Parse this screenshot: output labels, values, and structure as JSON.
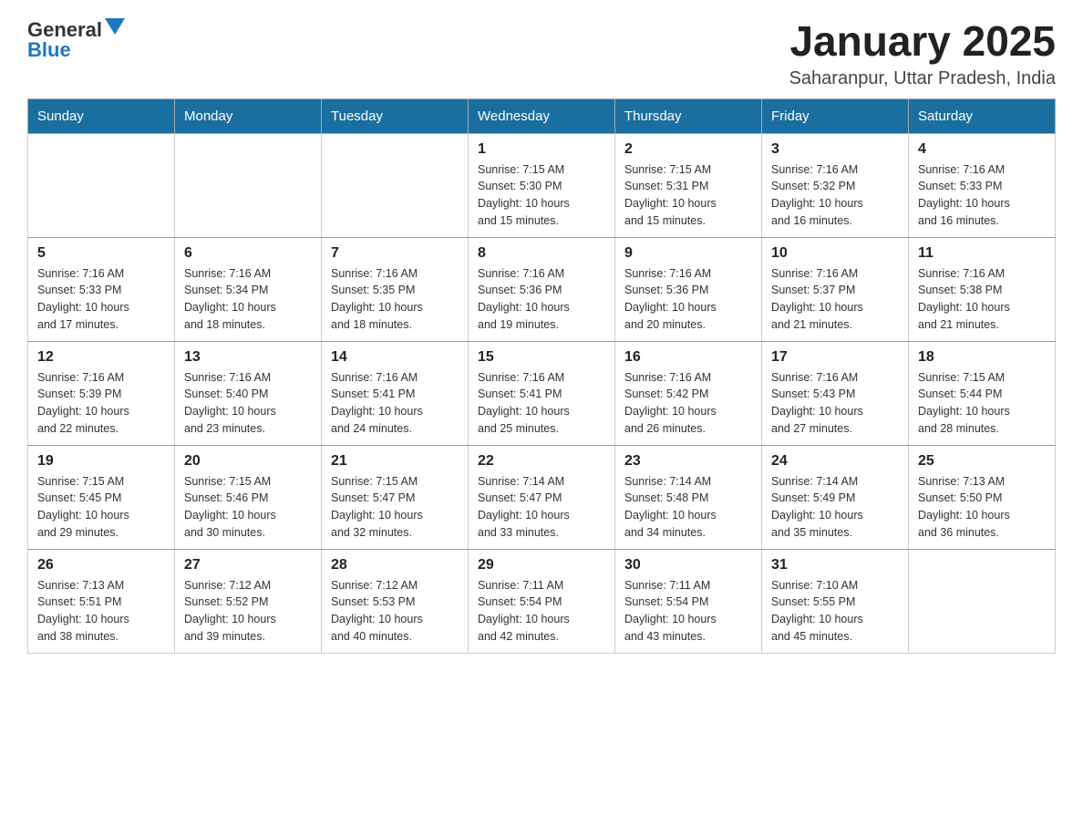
{
  "header": {
    "logo_general": "General",
    "logo_blue": "Blue",
    "month_title": "January 2025",
    "location": "Saharanpur, Uttar Pradesh, India"
  },
  "days_of_week": [
    "Sunday",
    "Monday",
    "Tuesday",
    "Wednesday",
    "Thursday",
    "Friday",
    "Saturday"
  ],
  "weeks": [
    [
      {
        "day": "",
        "info": ""
      },
      {
        "day": "",
        "info": ""
      },
      {
        "day": "",
        "info": ""
      },
      {
        "day": "1",
        "info": "Sunrise: 7:15 AM\nSunset: 5:30 PM\nDaylight: 10 hours\nand 15 minutes."
      },
      {
        "day": "2",
        "info": "Sunrise: 7:15 AM\nSunset: 5:31 PM\nDaylight: 10 hours\nand 15 minutes."
      },
      {
        "day": "3",
        "info": "Sunrise: 7:16 AM\nSunset: 5:32 PM\nDaylight: 10 hours\nand 16 minutes."
      },
      {
        "day": "4",
        "info": "Sunrise: 7:16 AM\nSunset: 5:33 PM\nDaylight: 10 hours\nand 16 minutes."
      }
    ],
    [
      {
        "day": "5",
        "info": "Sunrise: 7:16 AM\nSunset: 5:33 PM\nDaylight: 10 hours\nand 17 minutes."
      },
      {
        "day": "6",
        "info": "Sunrise: 7:16 AM\nSunset: 5:34 PM\nDaylight: 10 hours\nand 18 minutes."
      },
      {
        "day": "7",
        "info": "Sunrise: 7:16 AM\nSunset: 5:35 PM\nDaylight: 10 hours\nand 18 minutes."
      },
      {
        "day": "8",
        "info": "Sunrise: 7:16 AM\nSunset: 5:36 PM\nDaylight: 10 hours\nand 19 minutes."
      },
      {
        "day": "9",
        "info": "Sunrise: 7:16 AM\nSunset: 5:36 PM\nDaylight: 10 hours\nand 20 minutes."
      },
      {
        "day": "10",
        "info": "Sunrise: 7:16 AM\nSunset: 5:37 PM\nDaylight: 10 hours\nand 21 minutes."
      },
      {
        "day": "11",
        "info": "Sunrise: 7:16 AM\nSunset: 5:38 PM\nDaylight: 10 hours\nand 21 minutes."
      }
    ],
    [
      {
        "day": "12",
        "info": "Sunrise: 7:16 AM\nSunset: 5:39 PM\nDaylight: 10 hours\nand 22 minutes."
      },
      {
        "day": "13",
        "info": "Sunrise: 7:16 AM\nSunset: 5:40 PM\nDaylight: 10 hours\nand 23 minutes."
      },
      {
        "day": "14",
        "info": "Sunrise: 7:16 AM\nSunset: 5:41 PM\nDaylight: 10 hours\nand 24 minutes."
      },
      {
        "day": "15",
        "info": "Sunrise: 7:16 AM\nSunset: 5:41 PM\nDaylight: 10 hours\nand 25 minutes."
      },
      {
        "day": "16",
        "info": "Sunrise: 7:16 AM\nSunset: 5:42 PM\nDaylight: 10 hours\nand 26 minutes."
      },
      {
        "day": "17",
        "info": "Sunrise: 7:16 AM\nSunset: 5:43 PM\nDaylight: 10 hours\nand 27 minutes."
      },
      {
        "day": "18",
        "info": "Sunrise: 7:15 AM\nSunset: 5:44 PM\nDaylight: 10 hours\nand 28 minutes."
      }
    ],
    [
      {
        "day": "19",
        "info": "Sunrise: 7:15 AM\nSunset: 5:45 PM\nDaylight: 10 hours\nand 29 minutes."
      },
      {
        "day": "20",
        "info": "Sunrise: 7:15 AM\nSunset: 5:46 PM\nDaylight: 10 hours\nand 30 minutes."
      },
      {
        "day": "21",
        "info": "Sunrise: 7:15 AM\nSunset: 5:47 PM\nDaylight: 10 hours\nand 32 minutes."
      },
      {
        "day": "22",
        "info": "Sunrise: 7:14 AM\nSunset: 5:47 PM\nDaylight: 10 hours\nand 33 minutes."
      },
      {
        "day": "23",
        "info": "Sunrise: 7:14 AM\nSunset: 5:48 PM\nDaylight: 10 hours\nand 34 minutes."
      },
      {
        "day": "24",
        "info": "Sunrise: 7:14 AM\nSunset: 5:49 PM\nDaylight: 10 hours\nand 35 minutes."
      },
      {
        "day": "25",
        "info": "Sunrise: 7:13 AM\nSunset: 5:50 PM\nDaylight: 10 hours\nand 36 minutes."
      }
    ],
    [
      {
        "day": "26",
        "info": "Sunrise: 7:13 AM\nSunset: 5:51 PM\nDaylight: 10 hours\nand 38 minutes."
      },
      {
        "day": "27",
        "info": "Sunrise: 7:12 AM\nSunset: 5:52 PM\nDaylight: 10 hours\nand 39 minutes."
      },
      {
        "day": "28",
        "info": "Sunrise: 7:12 AM\nSunset: 5:53 PM\nDaylight: 10 hours\nand 40 minutes."
      },
      {
        "day": "29",
        "info": "Sunrise: 7:11 AM\nSunset: 5:54 PM\nDaylight: 10 hours\nand 42 minutes."
      },
      {
        "day": "30",
        "info": "Sunrise: 7:11 AM\nSunset: 5:54 PM\nDaylight: 10 hours\nand 43 minutes."
      },
      {
        "day": "31",
        "info": "Sunrise: 7:10 AM\nSunset: 5:55 PM\nDaylight: 10 hours\nand 45 minutes."
      },
      {
        "day": "",
        "info": ""
      }
    ]
  ]
}
